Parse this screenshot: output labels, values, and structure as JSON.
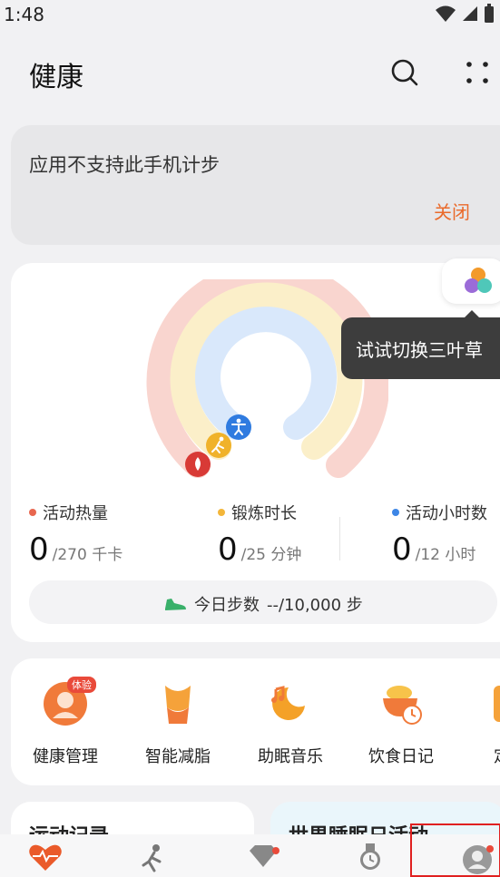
{
  "status_bar": {
    "time": "1:48",
    "icons": [
      "wifi-icon",
      "signal-icon",
      "battery-icon"
    ]
  },
  "header": {
    "title": "健康",
    "search_icon": "search-icon",
    "more_icon": "more-icon"
  },
  "notice": {
    "text": "应用不支持此手机计步",
    "close_label": "关闭",
    "accent": "#ea6a2a"
  },
  "tooltip": {
    "text": "试试切换三叶草"
  },
  "rings": {
    "colors": {
      "outer": "#f9d5cf",
      "middle": "#fbefc9",
      "inner": "#d9e8fb"
    },
    "icons": [
      "flame-icon",
      "run-icon",
      "stand-icon"
    ]
  },
  "metrics": [
    {
      "label": "活动热量",
      "value": "0",
      "goal": "/270 千卡",
      "color": "#e8674f"
    },
    {
      "label": "锻炼时长",
      "value": "0",
      "goal": "/25 分钟",
      "color": "#f3b63a"
    },
    {
      "label": "活动小时数",
      "value": "0",
      "goal": "/12 小时",
      "color": "#3d86e6"
    }
  ],
  "steps": {
    "label": "今日步数",
    "value": "--/10,000 步",
    "icon": "shoe-icon"
  },
  "services": [
    {
      "label": "健康管理",
      "badge": "体验",
      "icon": "health-manage-icon"
    },
    {
      "label": "智能减脂",
      "icon": "body-fat-icon"
    },
    {
      "label": "助眠音乐",
      "icon": "sleep-music-icon"
    },
    {
      "label": "饮食日记",
      "icon": "diet-diary-icon"
    },
    {
      "label": "定制",
      "icon": "custom-icon"
    }
  ],
  "cards": {
    "left_title": "运动记录",
    "right_title": "世界睡眠日活动"
  },
  "tabs": [
    {
      "name": "health",
      "icon": "heart-pulse-icon",
      "active": true
    },
    {
      "name": "exercise",
      "icon": "runner-icon"
    },
    {
      "name": "discover",
      "icon": "diamond-icon",
      "badge": true
    },
    {
      "name": "devices",
      "icon": "watch-icon"
    },
    {
      "name": "me",
      "icon": "profile-icon",
      "badge": true
    }
  ]
}
